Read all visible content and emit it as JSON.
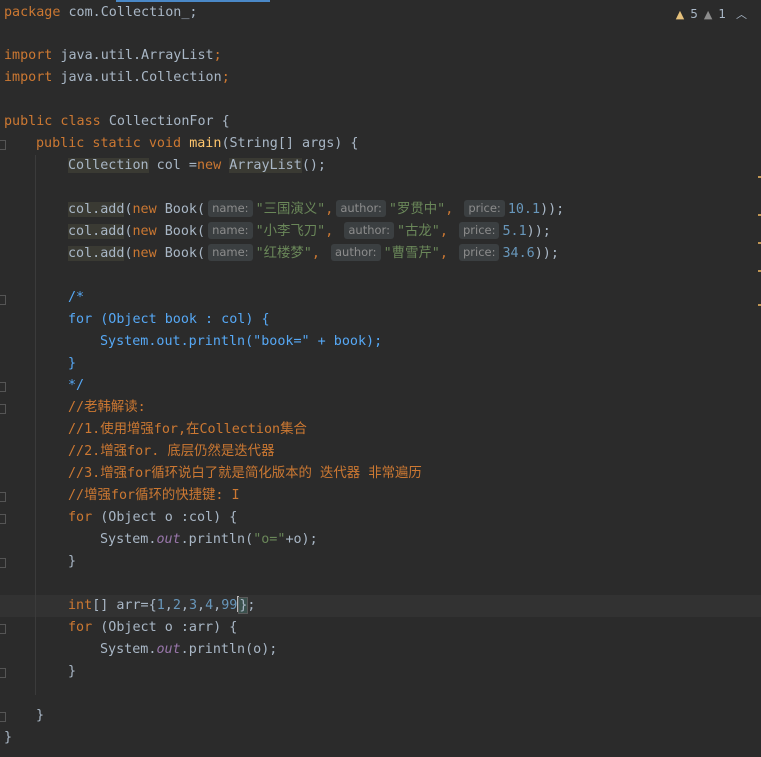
{
  "inspection": {
    "warning_count": "5",
    "weak_warning_count": "1"
  },
  "code": {
    "l1": "package com.Collection_;",
    "import1": "java.util.ArrayList",
    "import2": "java.util.Collection",
    "class_name": "CollectionFor",
    "method": "main",
    "params": "(String[] args) {",
    "col_decl_type": "Collection",
    "col_decl_mid": " col =",
    "col_decl_new": "new",
    "col_decl_arraylist": "ArrayList",
    "col_decl_end": "();",
    "books": [
      {
        "name": "\"三国演义\"",
        "author": "\"罗贯中\"",
        "price": "10.1"
      },
      {
        "name": "\"小李飞刀\"",
        "author": "\"古龙\"",
        "price": "5.1"
      },
      {
        "name": "\"红楼梦\"",
        "author": "\"曹雪芹\"",
        "price": "34.6"
      }
    ],
    "hint_name": "name:",
    "hint_author": "author:",
    "hint_price": "price:",
    "doc_open": "/*",
    "doc_for": "for (Object book : col) {",
    "doc_println": "System.out.println(\"book=\" + book);",
    "doc_close_brace": "}",
    "doc_end": "*/",
    "comment1": "//老韩解读:",
    "comment2": "//1.使用增强for,在Collection集合",
    "comment3": "//2.增强for. 底层仍然是迭代器",
    "comment4": "//3.增强for循环说白了就是简化版本的 迭代器 非常遍历",
    "comment5": "//增强for循环的快捷键: I",
    "for1_head": "(Object o :col) {",
    "println1_str": "\"o=\"",
    "println1_end": "+o);",
    "arr_decl": "int[] arr={",
    "arr_vals": [
      "1",
      "2",
      "3",
      "4",
      "99"
    ],
    "for2_head": "(Object o :arr) {",
    "println2_end": "println(o);"
  }
}
